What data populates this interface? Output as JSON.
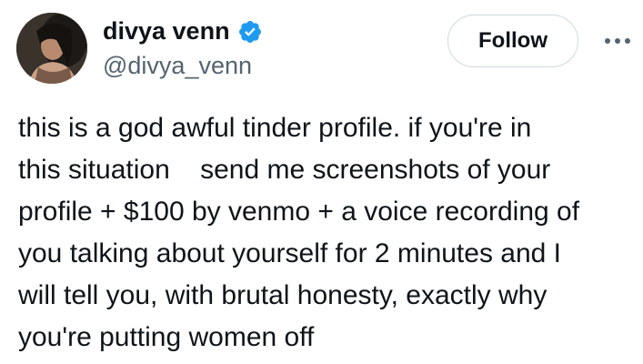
{
  "author": {
    "display_name": "divya venn",
    "handle": "@divya_venn",
    "verified": true,
    "verified_color": "#1d9bf0"
  },
  "actions": {
    "follow_label": "Follow",
    "more_icon": "more-dots-icon"
  },
  "tweet": {
    "lines": [
      "this is a god awful tinder profile. if you're in",
      "this situation    send me screenshots of your",
      "profile + $100 by venmo + a voice recording of",
      "you talking about yourself for 2 minutes and I",
      "will tell you, with brutal honesty, exactly why",
      "you're putting women off"
    ]
  }
}
